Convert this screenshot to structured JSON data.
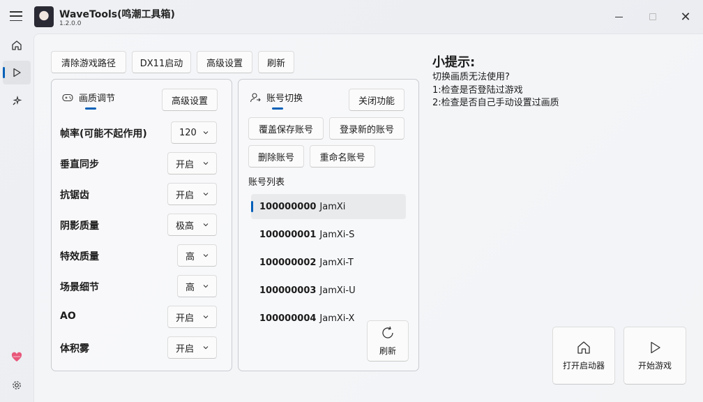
{
  "app": {
    "title": "WaveTools(鸣潮工具箱)",
    "version": "1.2.0.0"
  },
  "toolbar": {
    "clear_path": "清除游戏路径",
    "dx11": "DX11启动",
    "advanced": "高级设置",
    "refresh": "刷新"
  },
  "graphics": {
    "title": "画质调节",
    "advanced_button": "高级设置",
    "settings": [
      {
        "label": "帧率(可能不起作用)",
        "value": "120"
      },
      {
        "label": "垂直同步",
        "value": "开启"
      },
      {
        "label": "抗锯齿",
        "value": "开启"
      },
      {
        "label": "阴影质量",
        "value": "极高"
      },
      {
        "label": "特效质量",
        "value": "高"
      },
      {
        "label": "场景细节",
        "value": "高"
      },
      {
        "label": "AO",
        "value": "开启"
      },
      {
        "label": "体积雾",
        "value": "开启"
      }
    ]
  },
  "accounts": {
    "title": "账号切换",
    "close_feature": "关闭功能",
    "overwrite_save": "覆盖保存账号",
    "login_new": "登录新的账号",
    "delete": "删除账号",
    "rename": "重命名账号",
    "list_label": "账号列表",
    "list": [
      {
        "id": "100000000",
        "name": "JamXi"
      },
      {
        "id": "100000001",
        "name": "JamXi-S"
      },
      {
        "id": "100000002",
        "name": "JamXi-T"
      },
      {
        "id": "100000003",
        "name": "JamXi-U"
      },
      {
        "id": "100000004",
        "name": "JamXi-X"
      }
    ],
    "refresh": "刷新"
  },
  "tips": {
    "title": "小提示:",
    "lines": [
      "切换画质无法使用?",
      "1:检查是否登陆过游戏",
      "2:检查是否自己手动设置过画质"
    ]
  },
  "actions": {
    "open_launcher": "打开启动器",
    "start_game": "开始游戏"
  },
  "colors": {
    "accent": "#005fb8",
    "heart": "#e8577a"
  },
  "icons": {
    "nav": [
      "home-icon",
      "play-icon",
      "tools-icon",
      "heart-icon",
      "gear-icon"
    ]
  }
}
